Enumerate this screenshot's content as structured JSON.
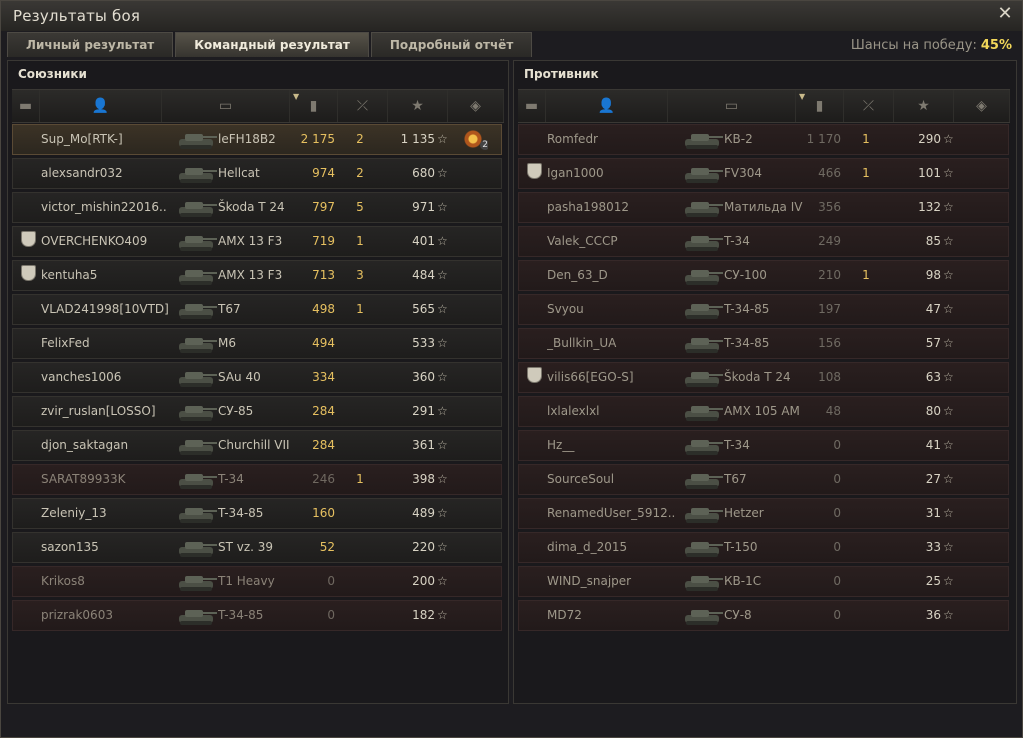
{
  "window": {
    "title": "Результаты боя",
    "close_glyph": "✕"
  },
  "tabs": [
    {
      "label": "Личный результат",
      "active": false
    },
    {
      "label": "Командный результат",
      "active": true
    },
    {
      "label": "Подробный отчёт",
      "active": false
    }
  ],
  "win_chance": {
    "label": "Шансы на победу:",
    "value": "45%"
  },
  "allies": {
    "title": "Союзники",
    "rows": [
      {
        "player": "Sup_Mo[RTK-]",
        "tank": "leFH18B2",
        "damage": "2 175",
        "kills": "2",
        "xp": "1 135",
        "state": "me",
        "badge": false,
        "medal": true,
        "medal_count": "2"
      },
      {
        "player": "alexsandr032",
        "tank": "Hellcat",
        "damage": "974",
        "kills": "2",
        "xp": "680",
        "state": "alive",
        "badge": false
      },
      {
        "player": "victor_mishin22016..",
        "tank": "Škoda T 24",
        "damage": "797",
        "kills": "5",
        "xp": "971",
        "state": "alive",
        "badge": false
      },
      {
        "player": "OVERCHENKO409",
        "tank": "AMX 13 F3",
        "damage": "719",
        "kills": "1",
        "xp": "401",
        "state": "alive",
        "badge": true
      },
      {
        "player": "kentuha5",
        "tank": "AMX 13 F3",
        "damage": "713",
        "kills": "3",
        "xp": "484",
        "state": "alive",
        "badge": true
      },
      {
        "player": "VLAD241998[10VTD]",
        "tank": "T67",
        "damage": "498",
        "kills": "1",
        "xp": "565",
        "state": "alive",
        "badge": false
      },
      {
        "player": "FelixFed",
        "tank": "M6",
        "damage": "494",
        "kills": "",
        "xp": "533",
        "state": "alive",
        "badge": false
      },
      {
        "player": "vanches1006",
        "tank": "SAu 40",
        "damage": "334",
        "kills": "",
        "xp": "360",
        "state": "alive",
        "badge": false
      },
      {
        "player": "zvir_ruslan[LOSSO]",
        "tank": "СУ-85",
        "damage": "284",
        "kills": "",
        "xp": "291",
        "state": "alive",
        "badge": false
      },
      {
        "player": "djon_saktagan",
        "tank": "Churchill VII",
        "damage": "284",
        "kills": "",
        "xp": "361",
        "state": "alive",
        "badge": false
      },
      {
        "player": "SARAT89933K",
        "tank": "T-34",
        "damage": "246",
        "kills": "1",
        "xp": "398",
        "state": "dead",
        "badge": false
      },
      {
        "player": "Zeleniy_13",
        "tank": "T-34-85",
        "damage": "160",
        "kills": "",
        "xp": "489",
        "state": "alive",
        "badge": false
      },
      {
        "player": "sazon135",
        "tank": "ST vz. 39",
        "damage": "52",
        "kills": "",
        "xp": "220",
        "state": "alive",
        "badge": false
      },
      {
        "player": "Krikos8",
        "tank": "T1 Heavy",
        "damage": "0",
        "kills": "",
        "xp": "200",
        "state": "dead",
        "badge": false
      },
      {
        "player": "prizrak0603",
        "tank": "T-34-85",
        "damage": "0",
        "kills": "",
        "xp": "182",
        "state": "dead",
        "badge": false
      }
    ]
  },
  "enemies": {
    "title": "Противник",
    "rows": [
      {
        "player": "Romfedr",
        "tank": "КВ-2",
        "damage": "1 170",
        "kills": "1",
        "xp": "290",
        "badge": false
      },
      {
        "player": "Igan1000",
        "tank": "FV304",
        "damage": "466",
        "kills": "1",
        "xp": "101",
        "badge": true
      },
      {
        "player": "pasha198012",
        "tank": "Матильда IV",
        "damage": "356",
        "kills": "",
        "xp": "132",
        "badge": false
      },
      {
        "player": "Valek_CCCP",
        "tank": "T-34",
        "damage": "249",
        "kills": "",
        "xp": "85",
        "badge": false
      },
      {
        "player": "Den_63_D",
        "tank": "СУ-100",
        "damage": "210",
        "kills": "1",
        "xp": "98",
        "badge": false
      },
      {
        "player": "Svyou",
        "tank": "T-34-85",
        "damage": "197",
        "kills": "",
        "xp": "47",
        "badge": false
      },
      {
        "player": "_Bullkin_UA",
        "tank": "T-34-85",
        "damage": "156",
        "kills": "",
        "xp": "57",
        "badge": false
      },
      {
        "player": "vilis66[EGO-S]",
        "tank": "Škoda T 24",
        "damage": "108",
        "kills": "",
        "xp": "63",
        "badge": true
      },
      {
        "player": "lxlalexlxl",
        "tank": "AMX 105 AM",
        "damage": "48",
        "kills": "",
        "xp": "80",
        "badge": false
      },
      {
        "player": "Hz__",
        "tank": "T-34",
        "damage": "0",
        "kills": "",
        "xp": "41",
        "badge": false
      },
      {
        "player": "SourceSoul",
        "tank": "T67",
        "damage": "0",
        "kills": "",
        "xp": "27",
        "badge": false
      },
      {
        "player": "RenamedUser_5912..",
        "tank": "Hetzer",
        "damage": "0",
        "kills": "",
        "xp": "31",
        "badge": false
      },
      {
        "player": "dima_d_2015",
        "tank": "T-150",
        "damage": "0",
        "kills": "",
        "xp": "33",
        "badge": false
      },
      {
        "player": "WIND_snajper",
        "tank": "КВ-1С",
        "damage": "0",
        "kills": "",
        "xp": "25",
        "badge": false
      },
      {
        "player": "MD72",
        "tank": "СУ-8",
        "damage": "0",
        "kills": "",
        "xp": "36",
        "badge": false
      }
    ]
  },
  "columns": {
    "icons": [
      "badge-icon",
      "player-icon",
      "tank-icon",
      "damage-icon",
      "kills-icon",
      "xp-icon",
      "medal-icon"
    ],
    "glyphs": [
      "▬",
      "👤",
      "▭",
      "▮",
      "⤫",
      "★",
      "◈"
    ]
  },
  "colors": {
    "accent": "#f2d75a",
    "damage": "#e6c060",
    "dead_row": "#2a1f1f",
    "me_row": "#3c3326"
  }
}
